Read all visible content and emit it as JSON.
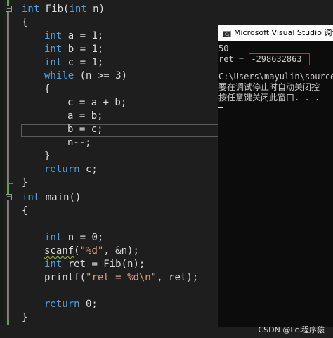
{
  "code": {
    "fib": {
      "signature": [
        "int",
        " Fib(",
        "int",
        " n)"
      ],
      "open_brace": "{",
      "decl_a": [
        "int",
        " a = 1;"
      ],
      "decl_b": [
        "int",
        " b = 1;"
      ],
      "decl_c": [
        "int",
        " c = 1;"
      ],
      "while_line": [
        "while",
        " (n >= 3)"
      ],
      "while_open": "{",
      "stmt_c": "c = a + b;",
      "stmt_a": "a = b;",
      "stmt_b": "b = c;",
      "stmt_n": "n--;",
      "while_close": "}",
      "return_line": [
        "return",
        " c;"
      ],
      "close_brace": "}"
    },
    "main": {
      "signature": [
        "int",
        " main()"
      ],
      "open_brace": "{",
      "decl_n": [
        "int",
        " n = 0;"
      ],
      "scanf_line": [
        "scanf",
        "(",
        "\"%d\"",
        ", &n);"
      ],
      "ret_line": [
        "int",
        " ret = Fib(n);"
      ],
      "printf_line": [
        "printf(",
        "\"ret = %d\\n\"",
        ", ret);"
      ],
      "return_line": [
        "return",
        " 0;"
      ],
      "close_brace": "}"
    }
  },
  "console": {
    "title": "Microsoft Visual Studio 调试控",
    "icon_text": "C\\",
    "input_value": "50",
    "ret_label": "ret = ",
    "ret_value": "-298632863",
    "path_line": "C:\\Users\\mayulin\\source\\",
    "msg_line1": "要在调试停止时自动关闭控",
    "msg_line2": "按任意键关闭此窗口. . ."
  },
  "watermark": "CSDN @Lc.程序猿",
  "colors": {
    "keyword": "#569cd6",
    "string": "#d69d85",
    "text": "#dcdcdc",
    "background": "#1e1e1e",
    "change_bar": "#57a64a",
    "highlight_box": "#d12a2a"
  }
}
